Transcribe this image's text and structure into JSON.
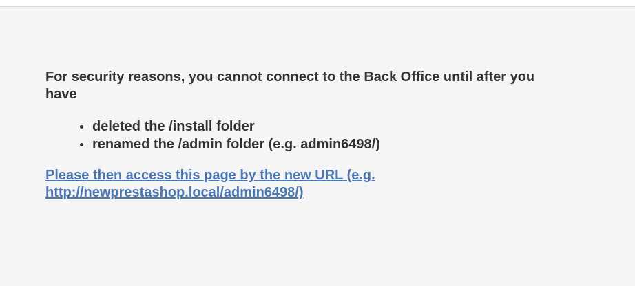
{
  "message": {
    "text": "For security reasons, you cannot connect to the Back Office until after you have"
  },
  "requirements": [
    {
      "text": "deleted the /install folder"
    },
    {
      "text": "renamed the /admin folder (e.g. admin6498/)"
    }
  ],
  "link": {
    "text": "Please then access this page by the new URL (e.g. http://newprestashop.local/admin6498/)"
  },
  "colors": {
    "text": "#333333",
    "link": "#4a76b2",
    "panel_background": "#f5f5f5"
  }
}
